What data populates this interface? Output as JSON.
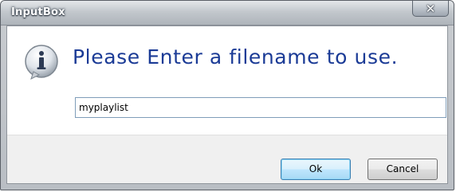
{
  "window": {
    "title": "InputBox",
    "close_glyph": "✕"
  },
  "dialog": {
    "icon": "info-icon",
    "prompt": "Please Enter a filename to use.",
    "filename_value": "myplaylist"
  },
  "buttons": {
    "ok_label": "Ok",
    "cancel_label": "Cancel"
  },
  "colors": {
    "prompt_text": "#1b3b96",
    "ok_border": "#3c7fb1"
  }
}
